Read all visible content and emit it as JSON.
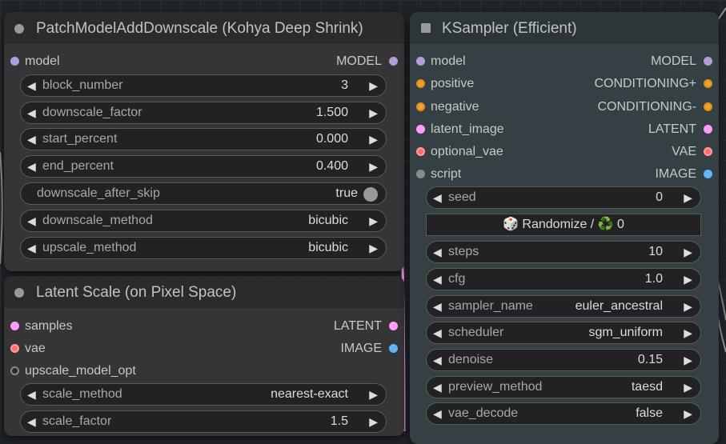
{
  "nodes": {
    "patch": {
      "title": "PatchModelAddDownscale (Kohya Deep Shrink)",
      "input_model": "model",
      "output_model": "MODEL",
      "widgets": [
        {
          "name": "block_number",
          "value": "3"
        },
        {
          "name": "downscale_factor",
          "value": "1.500"
        },
        {
          "name": "start_percent",
          "value": "0.000"
        },
        {
          "name": "end_percent",
          "value": "0.400"
        }
      ],
      "toggle": {
        "name": "downscale_after_skip",
        "value": "true"
      },
      "widgets2": [
        {
          "name": "downscale_method",
          "value": "bicubic"
        },
        {
          "name": "upscale_method",
          "value": "bicubic"
        }
      ]
    },
    "latent_scale": {
      "title": "Latent Scale (on Pixel Space)",
      "inputs": [
        "samples",
        "vae",
        "upscale_model_opt"
      ],
      "outputs": [
        "LATENT",
        "IMAGE"
      ],
      "widgets": [
        {
          "name": "scale_method",
          "value": "nearest-exact"
        },
        {
          "name": "scale_factor",
          "value": "1.5"
        }
      ]
    },
    "ksampler": {
      "title": "KSampler (Efficient)",
      "inputs": [
        "model",
        "positive",
        "negative",
        "latent_image",
        "optional_vae",
        "script"
      ],
      "outputs": [
        "MODEL",
        "CONDITIONING+",
        "CONDITIONING-",
        "LATENT",
        "VAE",
        "IMAGE"
      ],
      "seed": {
        "name": "seed",
        "value": "0"
      },
      "randomize_button": "🎲 Randomize / ♻️ 0",
      "widgets": [
        {
          "name": "steps",
          "value": "10"
        },
        {
          "name": "cfg",
          "value": "1.0"
        },
        {
          "name": "sampler_name",
          "value": "euler_ancestral"
        },
        {
          "name": "scheduler",
          "value": "sgm_uniform"
        },
        {
          "name": "denoise",
          "value": "0.15"
        },
        {
          "name": "preview_method",
          "value": "taesd"
        },
        {
          "name": "vae_decode",
          "value": "false"
        }
      ]
    }
  },
  "arrows": {
    "left": "◀",
    "right": "▶"
  },
  "colors": {
    "model": "#b39ddb",
    "conditioning": "#f0a030",
    "latent": "#ff9cf9",
    "vae": "#ff6e6e",
    "image": "#64b5f6"
  }
}
